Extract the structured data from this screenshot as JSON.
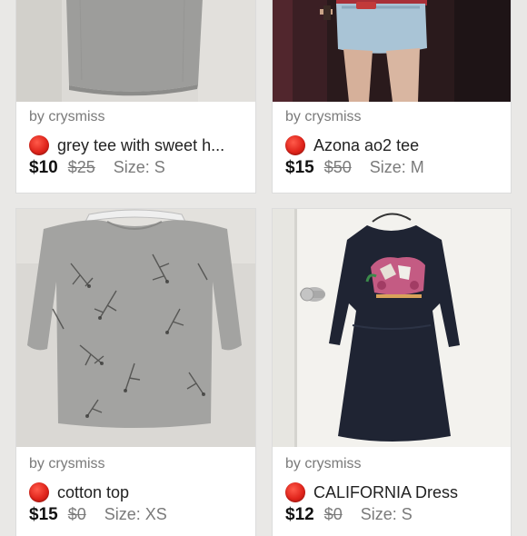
{
  "listings": [
    {
      "seller": "by crysmiss",
      "title": "grey tee with sweet h...",
      "price": "$10",
      "original_price": "$25",
      "size": "Size: S",
      "status_color": "#e0241b"
    },
    {
      "seller": "by crysmiss",
      "title": "Azona ao2 tee",
      "price": "$15",
      "original_price": "$50",
      "size": "Size: M",
      "status_color": "#e0241b"
    },
    {
      "seller": "by crysmiss",
      "title": "cotton top",
      "price": "$15",
      "original_price": "$0",
      "size": "Size: XS",
      "status_color": "#e0241b"
    },
    {
      "seller": "by crysmiss",
      "title": "CALIFORNIA Dress",
      "price": "$12",
      "original_price": "$0",
      "size": "Size: S",
      "status_color": "#e0241b"
    }
  ],
  "colors": {
    "background": "#e9e8e6",
    "card": "#ffffff",
    "muted_text": "#7a7a7a",
    "status_dot": "#e0241b"
  }
}
